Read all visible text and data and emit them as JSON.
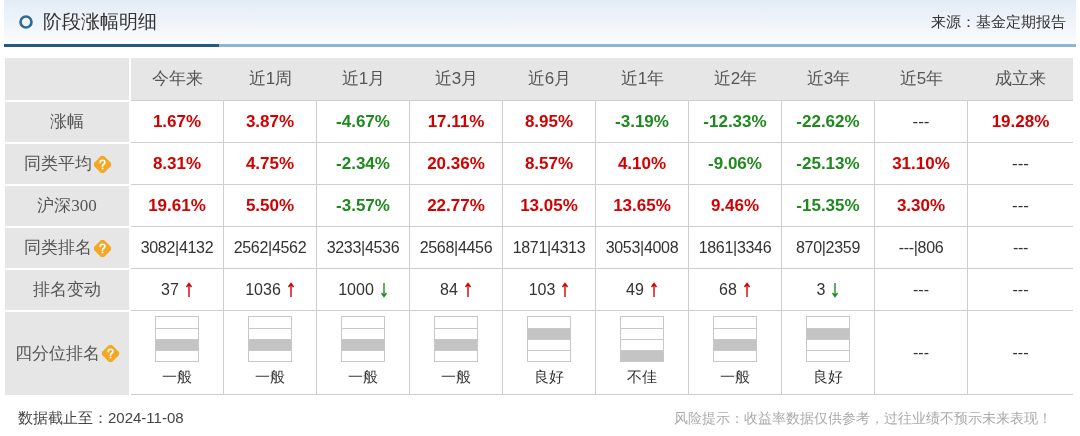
{
  "header": {
    "title": "阶段涨幅明细",
    "source": "来源：基金定期报告"
  },
  "columns": [
    "今年来",
    "近1周",
    "近1月",
    "近3月",
    "近6月",
    "近1年",
    "近2年",
    "近3年",
    "近5年",
    "成立来"
  ],
  "rows": [
    {
      "label": "涨幅",
      "help": false,
      "kind": "pct",
      "cells": [
        {
          "text": "1.67%",
          "color": "#d40000"
        },
        {
          "text": "3.87%",
          "color": "#d40000"
        },
        {
          "text": "-4.67%",
          "color": "#1e8a1e"
        },
        {
          "text": "17.11%",
          "color": "#d40000"
        },
        {
          "text": "8.95%",
          "color": "#d40000"
        },
        {
          "text": "-3.19%",
          "color": "#1e8a1e"
        },
        {
          "text": "-12.33%",
          "color": "#1e8a1e"
        },
        {
          "text": "-22.62%",
          "color": "#1e8a1e"
        },
        {
          "text": "---",
          "color": "#333333"
        },
        {
          "text": "19.28%",
          "color": "#d40000"
        }
      ]
    },
    {
      "label": "同类平均",
      "help": true,
      "kind": "pct",
      "cells": [
        {
          "text": "8.31%",
          "color": "#d40000"
        },
        {
          "text": "4.75%",
          "color": "#d40000"
        },
        {
          "text": "-2.34%",
          "color": "#1e8a1e"
        },
        {
          "text": "20.36%",
          "color": "#d40000"
        },
        {
          "text": "8.57%",
          "color": "#d40000"
        },
        {
          "text": "4.10%",
          "color": "#d40000"
        },
        {
          "text": "-9.06%",
          "color": "#1e8a1e"
        },
        {
          "text": "-25.13%",
          "color": "#1e8a1e"
        },
        {
          "text": "31.10%",
          "color": "#d40000"
        },
        {
          "text": "---",
          "color": "#333333"
        }
      ]
    },
    {
      "label": "沪深300",
      "help": false,
      "kind": "pct",
      "cells": [
        {
          "text": "19.61%",
          "color": "#d40000"
        },
        {
          "text": "5.50%",
          "color": "#d40000"
        },
        {
          "text": "-3.57%",
          "color": "#1e8a1e"
        },
        {
          "text": "22.77%",
          "color": "#d40000"
        },
        {
          "text": "13.05%",
          "color": "#d40000"
        },
        {
          "text": "13.65%",
          "color": "#d40000"
        },
        {
          "text": "9.46%",
          "color": "#d40000"
        },
        {
          "text": "-15.35%",
          "color": "#1e8a1e"
        },
        {
          "text": "3.30%",
          "color": "#d40000"
        },
        {
          "text": "---",
          "color": "#333333"
        }
      ]
    },
    {
      "label": "同类排名",
      "help": true,
      "kind": "rank",
      "cells": [
        {
          "text": "3082|4132"
        },
        {
          "text": "2562|4562"
        },
        {
          "text": "3233|4536"
        },
        {
          "text": "2568|4456"
        },
        {
          "text": "1871|4313"
        },
        {
          "text": "3053|4008"
        },
        {
          "text": "1861|3346"
        },
        {
          "text": "870|2359"
        },
        {
          "text": "---|806"
        },
        {
          "text": "---"
        }
      ]
    },
    {
      "label": "排名变动",
      "help": false,
      "kind": "change",
      "cells": [
        {
          "text": "37",
          "rising": true
        },
        {
          "text": "1036",
          "rising": true
        },
        {
          "text": "1000",
          "rising": false
        },
        {
          "text": "84",
          "rising": true
        },
        {
          "text": "103",
          "rising": true
        },
        {
          "text": "49",
          "rising": true
        },
        {
          "text": "68",
          "rising": true
        },
        {
          "text": "3",
          "rising": false
        },
        {
          "text": "---"
        },
        {
          "text": "---"
        }
      ]
    },
    {
      "label": "四分位排名",
      "help": true,
      "kind": "quartile",
      "cells": [
        {
          "bands": [
            false,
            false,
            true,
            false
          ],
          "text": "一般"
        },
        {
          "bands": [
            false,
            false,
            true,
            false
          ],
          "text": "一般"
        },
        {
          "bands": [
            false,
            false,
            true,
            false
          ],
          "text": "一般"
        },
        {
          "bands": [
            false,
            false,
            true,
            false
          ],
          "text": "一般"
        },
        {
          "bands": [
            false,
            true,
            false,
            false
          ],
          "text": "良好"
        },
        {
          "bands": [
            false,
            false,
            false,
            true
          ],
          "text": "不佳"
        },
        {
          "bands": [
            false,
            false,
            true,
            false
          ],
          "text": "一般"
        },
        {
          "bands": [
            false,
            true,
            false,
            false
          ],
          "text": "良好"
        },
        {
          "text": "---"
        },
        {
          "text": "---"
        }
      ]
    }
  ],
  "footer": {
    "date": "数据截止至：2024-11-08",
    "notice": "风险提示：收益率数据仅供参考，过往业绩不预示未来表现！"
  }
}
